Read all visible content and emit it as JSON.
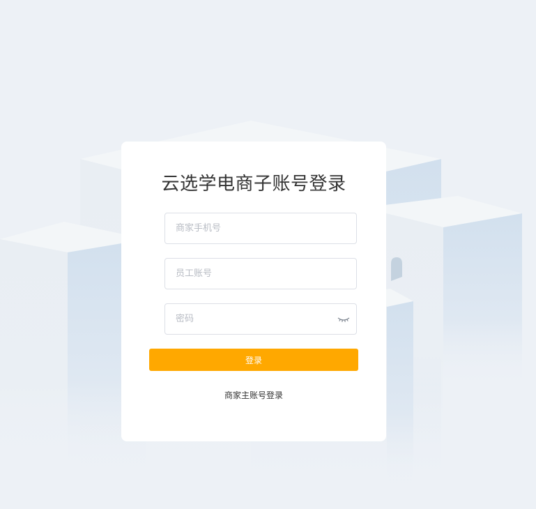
{
  "login": {
    "title": "云选学电商子账号登录",
    "phone": {
      "placeholder": "商家手机号",
      "value": ""
    },
    "staff": {
      "placeholder": "员工账号",
      "value": ""
    },
    "password": {
      "placeholder": "密码",
      "value": ""
    },
    "password_toggle_icon": "eye-closed-icon",
    "submit_label": "登录",
    "switch_label": "商家主账号登录"
  },
  "colors": {
    "background": "#edf1f6",
    "card": "#ffffff",
    "accent": "#ffa800",
    "title_text": "#333333",
    "placeholder_text": "#b8bcc4",
    "input_border": "#dcdfe6"
  }
}
